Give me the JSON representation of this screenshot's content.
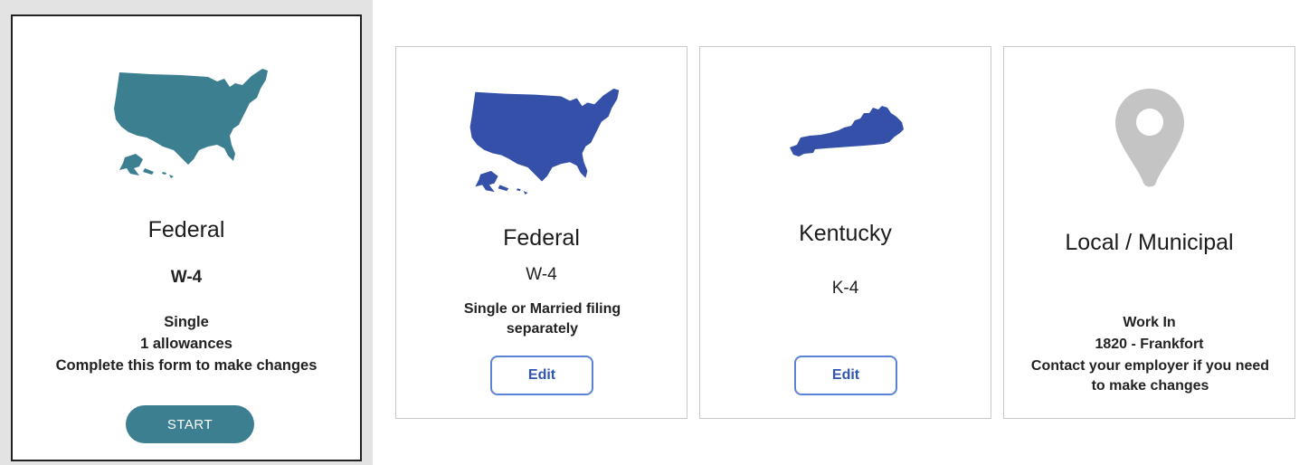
{
  "cards": {
    "federal_old": {
      "title": "Federal",
      "form": "W-4",
      "status": "Single",
      "allowances": "1 allowances",
      "note": "Complete this form to make changes",
      "button": "START",
      "icon": "usa-map-icon",
      "color": "#3b7f90"
    },
    "federal": {
      "title": "Federal",
      "form": "W-4",
      "status": "Single or Married filing separately",
      "button": "Edit",
      "icon": "usa-map-icon",
      "color": "#3450a8"
    },
    "kentucky": {
      "title": "Kentucky",
      "form": "K-4",
      "button": "Edit",
      "icon": "kentucky-map-icon",
      "color": "#3450a8"
    },
    "local": {
      "title": "Local / Municipal",
      "work_in_label": "Work In",
      "location": "1820 - Frankfort",
      "note": "Contact your employer if you need to make changes",
      "icon": "location-pin-icon",
      "color": "#c4c4c4"
    }
  },
  "colors": {
    "accent_teal": "#3b7f90",
    "accent_blue": "#3450a8",
    "edit_border": "#5a82d6",
    "pin_gray": "#c4c4c4"
  }
}
